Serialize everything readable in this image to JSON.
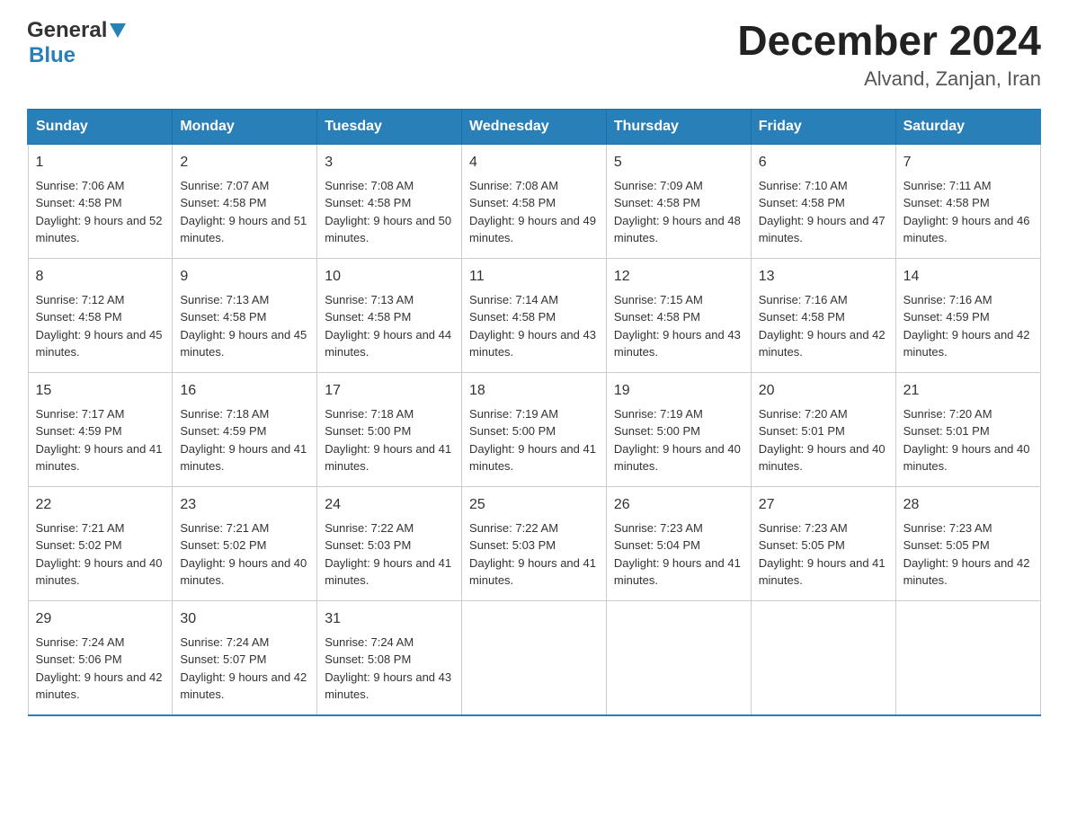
{
  "header": {
    "logo_general": "General",
    "logo_blue": "Blue",
    "month_title": "December 2024",
    "location": "Alvand, Zanjan, Iran"
  },
  "weekdays": [
    "Sunday",
    "Monday",
    "Tuesday",
    "Wednesday",
    "Thursday",
    "Friday",
    "Saturday"
  ],
  "weeks": [
    [
      {
        "day": "1",
        "sunrise": "Sunrise: 7:06 AM",
        "sunset": "Sunset: 4:58 PM",
        "daylight": "Daylight: 9 hours and 52 minutes."
      },
      {
        "day": "2",
        "sunrise": "Sunrise: 7:07 AM",
        "sunset": "Sunset: 4:58 PM",
        "daylight": "Daylight: 9 hours and 51 minutes."
      },
      {
        "day": "3",
        "sunrise": "Sunrise: 7:08 AM",
        "sunset": "Sunset: 4:58 PM",
        "daylight": "Daylight: 9 hours and 50 minutes."
      },
      {
        "day": "4",
        "sunrise": "Sunrise: 7:08 AM",
        "sunset": "Sunset: 4:58 PM",
        "daylight": "Daylight: 9 hours and 49 minutes."
      },
      {
        "day": "5",
        "sunrise": "Sunrise: 7:09 AM",
        "sunset": "Sunset: 4:58 PM",
        "daylight": "Daylight: 9 hours and 48 minutes."
      },
      {
        "day": "6",
        "sunrise": "Sunrise: 7:10 AM",
        "sunset": "Sunset: 4:58 PM",
        "daylight": "Daylight: 9 hours and 47 minutes."
      },
      {
        "day": "7",
        "sunrise": "Sunrise: 7:11 AM",
        "sunset": "Sunset: 4:58 PM",
        "daylight": "Daylight: 9 hours and 46 minutes."
      }
    ],
    [
      {
        "day": "8",
        "sunrise": "Sunrise: 7:12 AM",
        "sunset": "Sunset: 4:58 PM",
        "daylight": "Daylight: 9 hours and 45 minutes."
      },
      {
        "day": "9",
        "sunrise": "Sunrise: 7:13 AM",
        "sunset": "Sunset: 4:58 PM",
        "daylight": "Daylight: 9 hours and 45 minutes."
      },
      {
        "day": "10",
        "sunrise": "Sunrise: 7:13 AM",
        "sunset": "Sunset: 4:58 PM",
        "daylight": "Daylight: 9 hours and 44 minutes."
      },
      {
        "day": "11",
        "sunrise": "Sunrise: 7:14 AM",
        "sunset": "Sunset: 4:58 PM",
        "daylight": "Daylight: 9 hours and 43 minutes."
      },
      {
        "day": "12",
        "sunrise": "Sunrise: 7:15 AM",
        "sunset": "Sunset: 4:58 PM",
        "daylight": "Daylight: 9 hours and 43 minutes."
      },
      {
        "day": "13",
        "sunrise": "Sunrise: 7:16 AM",
        "sunset": "Sunset: 4:58 PM",
        "daylight": "Daylight: 9 hours and 42 minutes."
      },
      {
        "day": "14",
        "sunrise": "Sunrise: 7:16 AM",
        "sunset": "Sunset: 4:59 PM",
        "daylight": "Daylight: 9 hours and 42 minutes."
      }
    ],
    [
      {
        "day": "15",
        "sunrise": "Sunrise: 7:17 AM",
        "sunset": "Sunset: 4:59 PM",
        "daylight": "Daylight: 9 hours and 41 minutes."
      },
      {
        "day": "16",
        "sunrise": "Sunrise: 7:18 AM",
        "sunset": "Sunset: 4:59 PM",
        "daylight": "Daylight: 9 hours and 41 minutes."
      },
      {
        "day": "17",
        "sunrise": "Sunrise: 7:18 AM",
        "sunset": "Sunset: 5:00 PM",
        "daylight": "Daylight: 9 hours and 41 minutes."
      },
      {
        "day": "18",
        "sunrise": "Sunrise: 7:19 AM",
        "sunset": "Sunset: 5:00 PM",
        "daylight": "Daylight: 9 hours and 41 minutes."
      },
      {
        "day": "19",
        "sunrise": "Sunrise: 7:19 AM",
        "sunset": "Sunset: 5:00 PM",
        "daylight": "Daylight: 9 hours and 40 minutes."
      },
      {
        "day": "20",
        "sunrise": "Sunrise: 7:20 AM",
        "sunset": "Sunset: 5:01 PM",
        "daylight": "Daylight: 9 hours and 40 minutes."
      },
      {
        "day": "21",
        "sunrise": "Sunrise: 7:20 AM",
        "sunset": "Sunset: 5:01 PM",
        "daylight": "Daylight: 9 hours and 40 minutes."
      }
    ],
    [
      {
        "day": "22",
        "sunrise": "Sunrise: 7:21 AM",
        "sunset": "Sunset: 5:02 PM",
        "daylight": "Daylight: 9 hours and 40 minutes."
      },
      {
        "day": "23",
        "sunrise": "Sunrise: 7:21 AM",
        "sunset": "Sunset: 5:02 PM",
        "daylight": "Daylight: 9 hours and 40 minutes."
      },
      {
        "day": "24",
        "sunrise": "Sunrise: 7:22 AM",
        "sunset": "Sunset: 5:03 PM",
        "daylight": "Daylight: 9 hours and 41 minutes."
      },
      {
        "day": "25",
        "sunrise": "Sunrise: 7:22 AM",
        "sunset": "Sunset: 5:03 PM",
        "daylight": "Daylight: 9 hours and 41 minutes."
      },
      {
        "day": "26",
        "sunrise": "Sunrise: 7:23 AM",
        "sunset": "Sunset: 5:04 PM",
        "daylight": "Daylight: 9 hours and 41 minutes."
      },
      {
        "day": "27",
        "sunrise": "Sunrise: 7:23 AM",
        "sunset": "Sunset: 5:05 PM",
        "daylight": "Daylight: 9 hours and 41 minutes."
      },
      {
        "day": "28",
        "sunrise": "Sunrise: 7:23 AM",
        "sunset": "Sunset: 5:05 PM",
        "daylight": "Daylight: 9 hours and 42 minutes."
      }
    ],
    [
      {
        "day": "29",
        "sunrise": "Sunrise: 7:24 AM",
        "sunset": "Sunset: 5:06 PM",
        "daylight": "Daylight: 9 hours and 42 minutes."
      },
      {
        "day": "30",
        "sunrise": "Sunrise: 7:24 AM",
        "sunset": "Sunset: 5:07 PM",
        "daylight": "Daylight: 9 hours and 42 minutes."
      },
      {
        "day": "31",
        "sunrise": "Sunrise: 7:24 AM",
        "sunset": "Sunset: 5:08 PM",
        "daylight": "Daylight: 9 hours and 43 minutes."
      },
      null,
      null,
      null,
      null
    ]
  ]
}
